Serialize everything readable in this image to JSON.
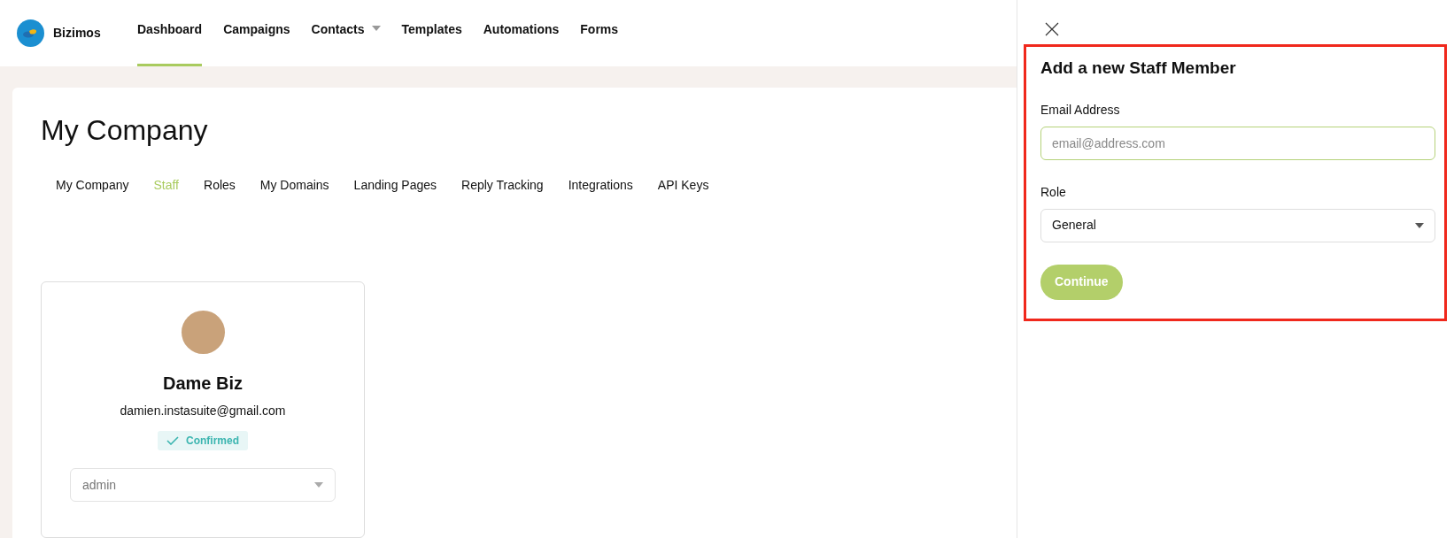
{
  "brand": {
    "name": "Bizimos"
  },
  "nav": [
    {
      "label": "Dashboard",
      "selected": true,
      "dropdown": false
    },
    {
      "label": "Campaigns",
      "selected": false,
      "dropdown": false
    },
    {
      "label": "Contacts",
      "selected": false,
      "dropdown": true
    },
    {
      "label": "Templates",
      "selected": false,
      "dropdown": false
    },
    {
      "label": "Automations",
      "selected": false,
      "dropdown": false
    },
    {
      "label": "Forms",
      "selected": false,
      "dropdown": false
    }
  ],
  "page": {
    "title": "My Company"
  },
  "tabs": [
    {
      "label": "My Company",
      "selected": false
    },
    {
      "label": "Staff",
      "selected": true
    },
    {
      "label": "Roles",
      "selected": false
    },
    {
      "label": "My Domains",
      "selected": false
    },
    {
      "label": "Landing Pages",
      "selected": false
    },
    {
      "label": "Reply Tracking",
      "selected": false
    },
    {
      "label": "Integrations",
      "selected": false
    },
    {
      "label": "API Keys",
      "selected": false
    }
  ],
  "staff": [
    {
      "name": "Dame Biz",
      "email": "damien.instasuite@gmail.com",
      "status": "Confirmed",
      "confirmed": true,
      "role": "admin"
    }
  ],
  "panel": {
    "title": "Add a new Staff Member",
    "email_label": "Email Address",
    "email_placeholder": "email@address.com",
    "role_label": "Role",
    "role_value": "General",
    "submit": "Continue",
    "highlighted": true
  }
}
